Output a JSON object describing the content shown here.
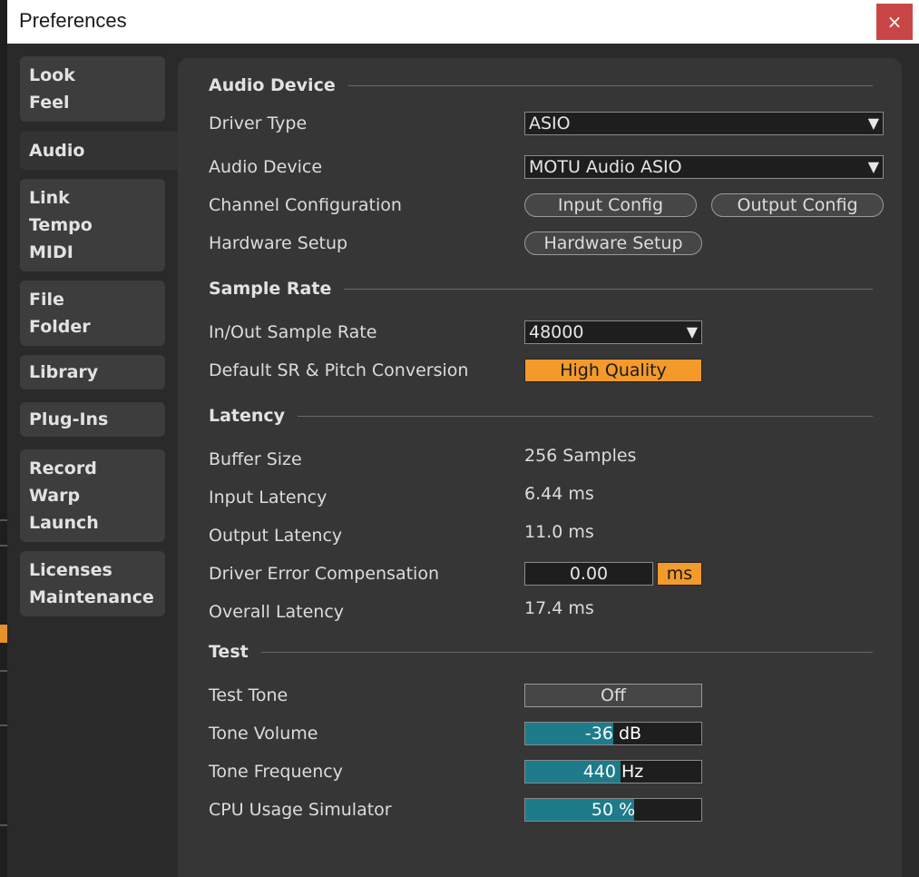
{
  "window": {
    "title": "Preferences",
    "close_glyph": "×"
  },
  "sidebar": {
    "items": [
      {
        "lines": [
          "Look",
          "Feel"
        ]
      },
      {
        "lines": [
          "Audio"
        ],
        "active": true
      },
      {
        "lines": [
          "Link",
          "Tempo",
          "MIDI"
        ]
      },
      {
        "lines": [
          "File",
          "Folder"
        ]
      },
      {
        "lines": [
          "Library"
        ]
      },
      {
        "lines": [
          "Plug-Ins"
        ]
      },
      {
        "lines": [
          "Record",
          "Warp",
          "Launch"
        ]
      },
      {
        "lines": [
          "Licenses",
          "Maintenance"
        ]
      }
    ]
  },
  "audio_device": {
    "heading": "Audio Device",
    "driver_type_label": "Driver Type",
    "driver_type_value": "ASIO",
    "audio_device_label": "Audio Device",
    "audio_device_value": "MOTU Audio ASIO",
    "channel_config_label": "Channel Configuration",
    "input_config_button": "Input Config",
    "output_config_button": "Output Config",
    "hardware_setup_label": "Hardware Setup",
    "hardware_setup_button": "Hardware Setup"
  },
  "sample_rate": {
    "heading": "Sample Rate",
    "in_out_label": "In/Out Sample Rate",
    "in_out_value": "48000",
    "default_sr_label": "Default SR & Pitch Conversion",
    "default_sr_value": "High Quality"
  },
  "latency": {
    "heading": "Latency",
    "buffer_size_label": "Buffer Size",
    "buffer_size_value": "256 Samples",
    "input_latency_label": "Input Latency",
    "input_latency_value": "6.44 ms",
    "output_latency_label": "Output Latency",
    "output_latency_value": "11.0 ms",
    "driver_error_label": "Driver Error Compensation",
    "driver_error_value": "0.00",
    "driver_error_unit": "ms",
    "overall_latency_label": "Overall Latency",
    "overall_latency_value": "17.4 ms"
  },
  "test": {
    "heading": "Test",
    "test_tone_label": "Test Tone",
    "test_tone_value": "Off",
    "tone_volume_label": "Tone Volume",
    "tone_volume_value": "-36 dB",
    "tone_volume_fill": 0.5,
    "tone_frequency_label": "Tone Frequency",
    "tone_frequency_value": "440 Hz",
    "tone_frequency_fill": 0.54,
    "cpu_usage_label": "CPU Usage Simulator",
    "cpu_usage_value": "50 %",
    "cpu_usage_fill": 0.62
  },
  "colors": {
    "accent_orange": "#f39a2b",
    "slider_teal": "#1d7b8a",
    "close_red": "#c84646"
  },
  "icons": {
    "dropdown": "dropdown-arrow-icon",
    "close": "close-icon"
  }
}
